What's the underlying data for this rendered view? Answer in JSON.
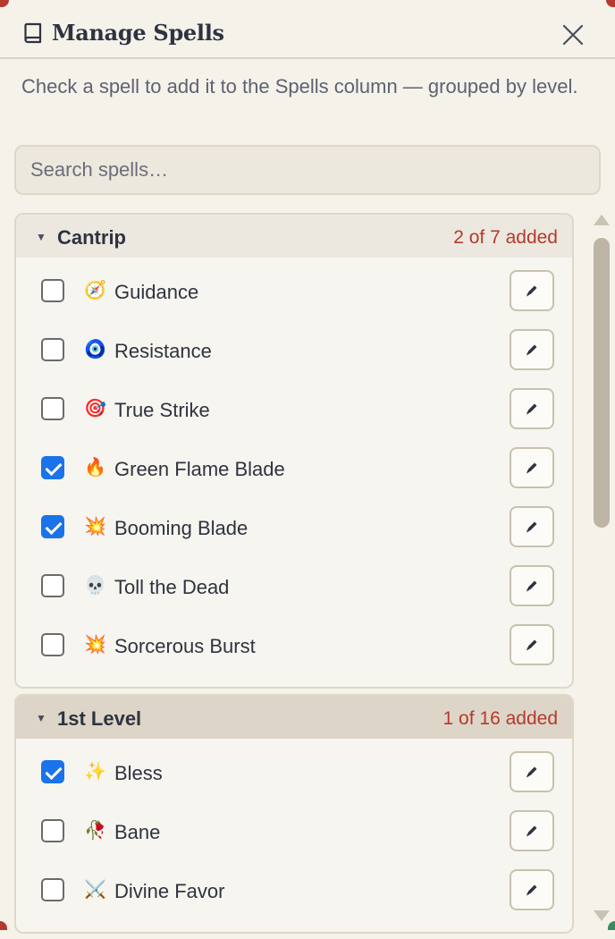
{
  "header": {
    "title": "Manage Spells",
    "icon": "book-icon",
    "close_icon": "close-icon"
  },
  "instructions": "Check a spell to add it to the Spells column — grouped by level.",
  "search": {
    "placeholder": "Search spells…",
    "value": ""
  },
  "colors": {
    "accent": "#b5392e",
    "checkbox_checked": "#1a73e8",
    "panel": "#f5f2ea"
  },
  "groups": [
    {
      "name": "Cantrip",
      "count": "2 of 7 added",
      "spells": [
        {
          "name": "Guidance",
          "icon": "🧭",
          "checked": false
        },
        {
          "name": "Resistance",
          "icon": "🧿",
          "checked": false
        },
        {
          "name": "True Strike",
          "icon": "🎯",
          "checked": false
        },
        {
          "name": "Green Flame Blade",
          "icon": "🔥",
          "checked": true
        },
        {
          "name": "Booming Blade",
          "icon": "💥",
          "checked": true
        },
        {
          "name": "Toll the Dead",
          "icon": "💀",
          "checked": false
        },
        {
          "name": "Sorcerous Burst",
          "icon": "💥",
          "checked": false
        }
      ]
    },
    {
      "name": "1st Level",
      "count": "1 of 16 added",
      "spells": [
        {
          "name": "Bless",
          "icon": "✨",
          "checked": true
        },
        {
          "name": "Bane",
          "icon": "🥀",
          "checked": false
        },
        {
          "name": "Divine Favor",
          "icon": "⚔️",
          "checked": false
        }
      ]
    }
  ]
}
